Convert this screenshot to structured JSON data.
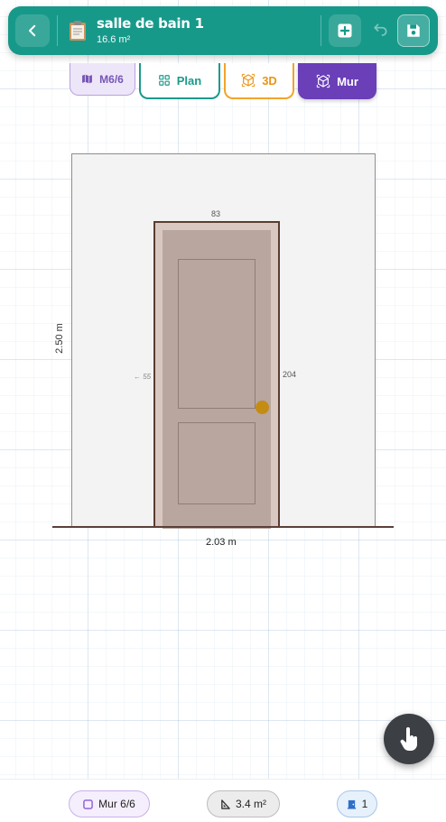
{
  "header": {
    "title": "salle de bain 1",
    "area": "16.6 m²"
  },
  "tabs": {
    "m_label": "M6/6",
    "plan_label": "Plan",
    "three_d_label": "3D",
    "mur_label": "Mur"
  },
  "drawing": {
    "door_width": "83",
    "door_height": "204",
    "left_offset": "← 55",
    "wall_height": "2.50 m",
    "wall_width": "2.03 m"
  },
  "footer": {
    "wall_chip": "Mur 6/6",
    "area_chip": "3.4 m²",
    "count_chip": "1"
  },
  "colors": {
    "header": "#17998a",
    "mur_active": "#6a3fb8",
    "plan": "#1a9a8b",
    "three_d": "#f1a42a",
    "door": "#b8a69f",
    "knob": "#c48c13"
  }
}
